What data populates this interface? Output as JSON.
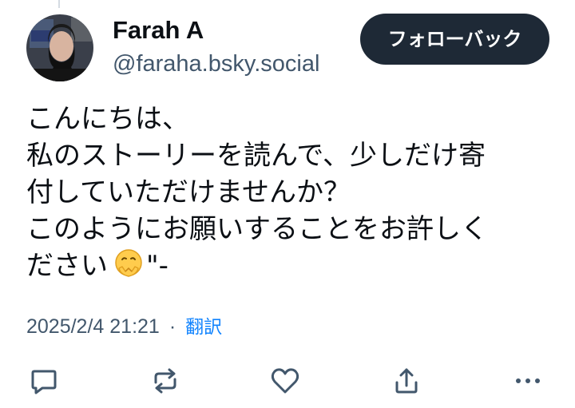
{
  "author": {
    "display_name": "Farah A",
    "handle": "@faraha.bsky.social",
    "avatar_icon": "avatar-photo"
  },
  "follow_button": {
    "label": "フォローバック"
  },
  "post": {
    "lines": [
      "こんにちは、",
      "私のストーリーを読んで、少しだけ寄",
      "付していただけませんか？",
      "このようにお願いすることをお許しく",
      "ださい"
    ],
    "emoji_icon": "pleading-hands-emoji",
    "trailing_text": "\"-"
  },
  "meta": {
    "timestamp": "2025/2/4 21:21",
    "separator": "·",
    "translate_label": "翻訳"
  },
  "actions": {
    "reply_icon": "reply-icon",
    "repost_icon": "repost-icon",
    "like_icon": "heart-icon",
    "share_icon": "share-icon",
    "more_icon": "more-icon"
  },
  "colors": {
    "text_primary": "#0b0f14",
    "text_secondary": "#42576c",
    "link": "#1083fe",
    "button_bg": "#1e2936",
    "icon": "#42576c"
  }
}
